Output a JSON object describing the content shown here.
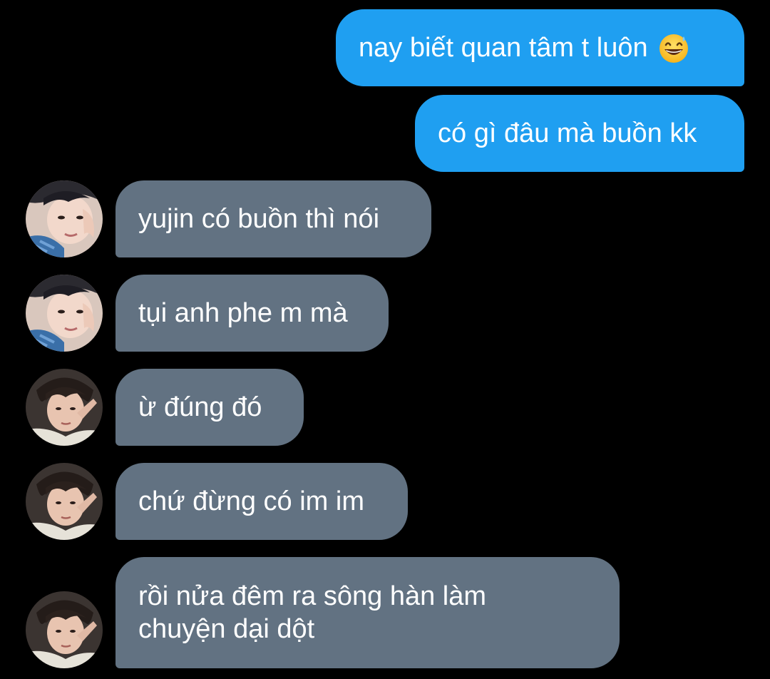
{
  "conversation": {
    "messages": [
      {
        "direction": "outgoing",
        "text": "nay biết quan tâm t luôn",
        "emoji": "grinning-face-with-sweat-emoji"
      },
      {
        "direction": "outgoing",
        "text": "có gì đâu mà buồn kk"
      },
      {
        "direction": "incoming",
        "sender": "user-a",
        "text": "yujin có buồn thì nói"
      },
      {
        "direction": "incoming",
        "sender": "user-a",
        "text": "tụi anh phe m mà"
      },
      {
        "direction": "incoming",
        "sender": "user-b",
        "text": "ừ đúng đó"
      },
      {
        "direction": "incoming",
        "sender": "user-b",
        "text": "chứ đừng có im im"
      },
      {
        "direction": "incoming",
        "sender": "user-b",
        "text": "rồi nửa đêm ra sông hàn làm chuyện dại dột"
      }
    ]
  },
  "colors": {
    "background": "#000000",
    "outgoing_bubble": "#1f9ff1",
    "incoming_bubble": "#627282",
    "text": "#ffffff"
  }
}
